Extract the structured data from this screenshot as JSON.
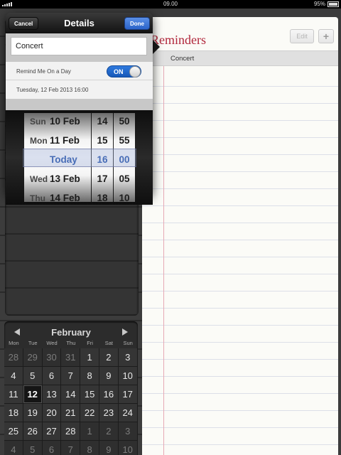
{
  "status_bar": {
    "time": "09.00",
    "battery": "95%"
  },
  "reminders": {
    "title": "Reminders",
    "edit_label": "Edit",
    "add_label": "+",
    "items": [
      {
        "title": "Concert"
      }
    ]
  },
  "popover": {
    "title": "Details",
    "cancel_label": "Cancel",
    "done_label": "Done",
    "reminder_title": "Concert",
    "remind_label": "Remind Me On a Day",
    "toggle_label": "ON",
    "toggle_on": true,
    "date_text": "Tuesday, 12 Feb 2013 16:00"
  },
  "picker": {
    "days": [
      {
        "dow": "Sun",
        "label": "10 Feb"
      },
      {
        "dow": "Mon",
        "label": "11 Feb"
      },
      {
        "dow": "",
        "label": "Today"
      },
      {
        "dow": "Wed",
        "label": "13 Feb"
      },
      {
        "dow": "Thu",
        "label": "14 Feb"
      }
    ],
    "hours": [
      "14",
      "15",
      "16",
      "17",
      "18"
    ],
    "minutes": [
      "50",
      "55",
      "00",
      "05",
      "10"
    ],
    "selected_index": 2
  },
  "calendar": {
    "month": "February",
    "weekdays": [
      "Mon",
      "Tue",
      "Wed",
      "Thu",
      "Fri",
      "Sat",
      "Sun"
    ],
    "weeks": [
      [
        "28",
        "29",
        "30",
        "31",
        "1",
        "2",
        "3"
      ],
      [
        "4",
        "5",
        "6",
        "7",
        "8",
        "9",
        "10"
      ],
      [
        "11",
        "12",
        "13",
        "14",
        "15",
        "16",
        "17"
      ],
      [
        "18",
        "19",
        "20",
        "21",
        "22",
        "23",
        "24"
      ],
      [
        "25",
        "26",
        "27",
        "28",
        "1",
        "2",
        "3"
      ],
      [
        "4",
        "5",
        "6",
        "7",
        "8",
        "9",
        "10"
      ]
    ],
    "muted": [
      [
        true,
        true,
        true,
        true,
        false,
        false,
        false
      ],
      [
        false,
        false,
        false,
        false,
        false,
        false,
        false
      ],
      [
        false,
        false,
        false,
        false,
        false,
        false,
        false
      ],
      [
        false,
        false,
        false,
        false,
        false,
        false,
        false
      ],
      [
        false,
        false,
        false,
        false,
        true,
        true,
        true
      ],
      [
        true,
        true,
        true,
        true,
        true,
        true,
        true
      ]
    ],
    "today_week": 2,
    "today_col": 1
  }
}
